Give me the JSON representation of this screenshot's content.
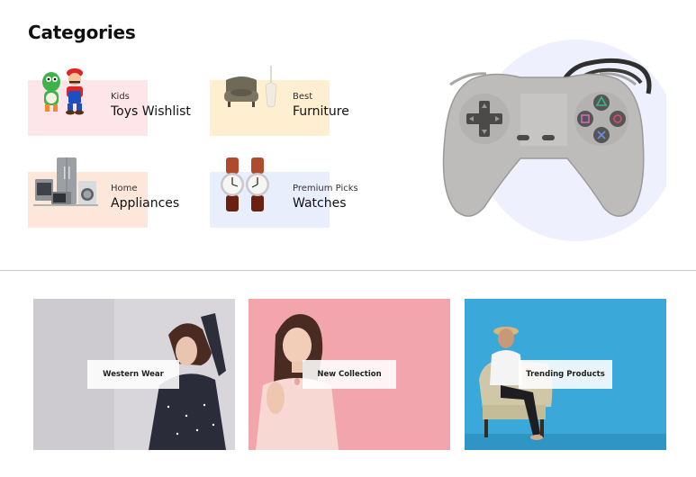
{
  "categories_section": {
    "title": "Categories",
    "items": [
      {
        "subtitle": "Kids",
        "name": "Toys Wishlist",
        "bg": "#fde5ea",
        "icon": "mario-toys-icon"
      },
      {
        "subtitle": "Best",
        "name": "Furniture",
        "bg": "#fdefcf",
        "icon": "armchair-lamp-icon"
      },
      {
        "subtitle": "Home",
        "name": "Appliances",
        "bg": "#fde6da",
        "icon": "home-appliances-icon"
      },
      {
        "subtitle": "Premium Picks",
        "name": "Watches",
        "bg": "#e8eefb",
        "icon": "wristwatches-icon"
      }
    ],
    "hero": {
      "icon": "game-controller-icon",
      "circle_color": "#eef1fd"
    }
  },
  "promos": [
    {
      "label": "Western Wear",
      "bg": "#d9d6db"
    },
    {
      "label": "New Collection",
      "bg": "#f3a5ad"
    },
    {
      "label": "Trending Products",
      "bg": "#3aa8d8"
    }
  ]
}
